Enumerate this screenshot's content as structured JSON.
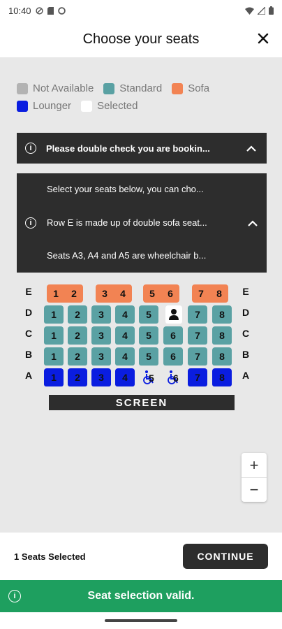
{
  "status_bar": {
    "time": "10:40"
  },
  "header": {
    "title": "Choose your seats",
    "close_icon": "close-icon"
  },
  "legend": {
    "items": [
      {
        "label": "Not Available",
        "color": "#b3b3b3"
      },
      {
        "label": "Standard",
        "color": "#5aa1a3"
      },
      {
        "label": "Sofa",
        "color": "#f28353"
      },
      {
        "label": "Lounger",
        "color": "#0a1de0"
      },
      {
        "label": "Selected",
        "color": "#ffffff"
      }
    ]
  },
  "notices": {
    "collapsed_text": "Please double check you are bookin...",
    "expanded_lines": [
      "Select your seats below, you can cho...",
      "Row E is made up of double sofa seat...",
      "Seats A3, A4 and A5 are wheelchair b..."
    ]
  },
  "seat_map": {
    "rows": [
      "E",
      "D",
      "C",
      "B",
      "A"
    ],
    "seat_numbers": [
      "1",
      "2",
      "3",
      "4",
      "5",
      "6",
      "7",
      "8"
    ],
    "screen_label": "SCREEN"
  },
  "zoom": {
    "in_label": "+",
    "out_label": "−"
  },
  "footer": {
    "seats_selected": "1 Seats Selected",
    "continue_label": "CONTINUE"
  },
  "toast": {
    "message": "Seat selection valid."
  },
  "colors": {
    "dark": "#2d2d2d",
    "success": "#1e9f5f",
    "standard": "#5aa1a3",
    "sofa": "#f28353",
    "lounger": "#0a1de0"
  }
}
